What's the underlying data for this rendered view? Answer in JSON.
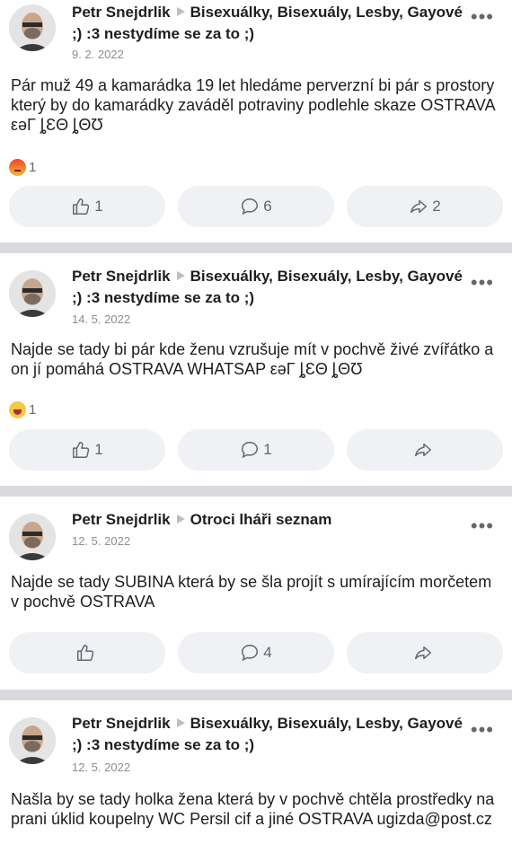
{
  "posts": [
    {
      "author": "Petr Snejdrlik",
      "group": "Bisexuálky, Bisexuály, Lesby, Gayové ;) :3 nestydíme se za to ;)",
      "date": "9. 2. 2022",
      "text": "Pár muž 49 a kamarádka 19 let hledáme perverzní bi pár s prostory který by do kamarádky zaváděl potraviny podlehle skaze OSTRAVA εəΓ ȴƐΘ ȴΘƱ",
      "reaction": {
        "type": "angry",
        "count": "1"
      },
      "likes": "1",
      "comments": "6",
      "shares": "2"
    },
    {
      "author": "Petr Snejdrlik",
      "group": "Bisexuálky, Bisexuály, Lesby, Gayové ;) :3 nestydíme se za to ;)",
      "date": "14. 5. 2022",
      "text": "Najde se tady bi pár kde ženu vzrušuje mít v pochvě živé zvířátko a on jí pomáhá OSTRAVA WHATSAP εəΓ ȴƐΘ ȴΘƱ",
      "reaction": {
        "type": "haha",
        "count": "1"
      },
      "likes": "1",
      "comments": "1",
      "shares": ""
    },
    {
      "author": "Petr Snejdrlik",
      "group": "Otroci lháři seznam",
      "date": "12. 5. 2022",
      "text": "Najde se tady SUBINA která by se šla projít s umírajícím morčetem v pochvě OSTRAVA",
      "likes": "",
      "comments": "4",
      "shares": ""
    },
    {
      "author": "Petr Snejdrlik",
      "group": "Bisexuálky, Bisexuály, Lesby, Gayové ;) :3 nestydíme se za to ;)",
      "date": "12. 5. 2022",
      "text": "Našla by se tady holka žena která by v pochvě chtěla prostředky na prani úklid koupelny WC Persil cif a jiné OSTRAVA ugizda@post.cz"
    }
  ],
  "more_glyph": "•••"
}
